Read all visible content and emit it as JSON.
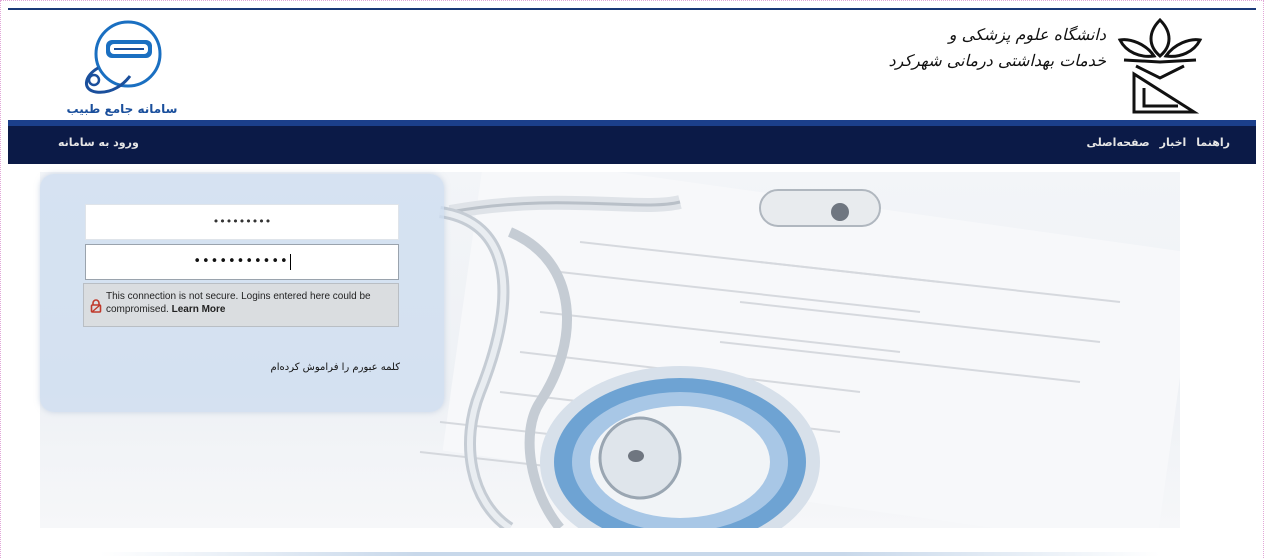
{
  "header": {
    "system_name": "سامانه جامع طبیب",
    "university_line1": "دانشگاه علوم پزشکی و",
    "university_line2": "خدمات بهداشتی درمانی شهرکرد"
  },
  "nav": {
    "login_label": "ورود به سامانه",
    "menu": [
      "صفحه‌اصلی",
      "اخبار",
      "راهنما"
    ]
  },
  "login": {
    "username_value": "•••••••••",
    "password_value": "•••••••••••",
    "warning_text": "This connection is not secure. Logins entered here could be compromised.",
    "warning_link": "Learn More",
    "forgot_password": "کلمه عبورم را فراموش کرده‌ام"
  },
  "colors": {
    "navbar": "#0b1a47",
    "accent": "#1b3f8b",
    "panel": "#cddcf0"
  }
}
